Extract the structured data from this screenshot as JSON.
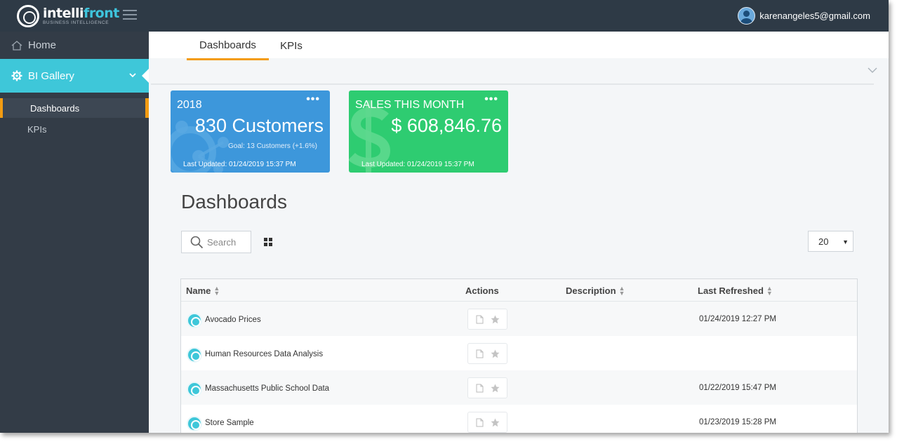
{
  "header": {
    "brand_name": "intellifront",
    "brand_name_plain": "intelli",
    "brand_name_accent": "front",
    "brand_tagline": "BUSINESS INTELLIGENCE",
    "user_email": "karenangeles5@gmail.com"
  },
  "sidebar": {
    "home_label": "Home",
    "gallery_label": "BI Gallery",
    "sub_items": [
      {
        "label": "Dashboards",
        "active": true
      },
      {
        "label": "KPIs",
        "active": false
      }
    ]
  },
  "tabs": [
    {
      "label": "Dashboards",
      "active": true
    },
    {
      "label": "KPIs",
      "active": false
    }
  ],
  "kpis": [
    {
      "title": "2018",
      "value": "830 Customers",
      "goal": "Goal: 13 Customers (+1.6%)",
      "updated": "Last Updated: 01/24/2019 15:37 PM",
      "color": "#3d97db"
    },
    {
      "title": "SALES THIS MONTH",
      "value": "$ 608,846.76",
      "updated": "Last Updated: 01/24/2019 15:37 PM",
      "color": "#2ecc71"
    }
  ],
  "page_title": "Dashboards",
  "search": {
    "placeholder": "Search"
  },
  "page_size": "20",
  "table": {
    "columns": [
      "Name",
      "Actions",
      "Description",
      "Last Refreshed"
    ],
    "rows": [
      {
        "name": "Avocado Prices",
        "description": "",
        "last_refreshed": "01/24/2019 12:27 PM"
      },
      {
        "name": "Human Resources Data Analysis",
        "description": "",
        "last_refreshed": ""
      },
      {
        "name": "Massachusetts Public School Data",
        "description": "",
        "last_refreshed": "01/22/2019 15:47 PM"
      },
      {
        "name": "Store Sample",
        "description": "",
        "last_refreshed": "01/23/2019 15:28 PM"
      }
    ]
  },
  "colors": {
    "topbar": "#2e3a46",
    "sidebar": "#333c47",
    "accent_teal": "#3ec7d9",
    "accent_orange": "#f39c12"
  },
  "icons": {
    "home": "home-icon",
    "gallery": "gear-icon",
    "menu": "hamburger-icon",
    "search": "search-icon",
    "grid": "grid-view-icon",
    "document": "document-icon",
    "favorite": "star-icon",
    "dashboard": "dashboard-icon"
  }
}
